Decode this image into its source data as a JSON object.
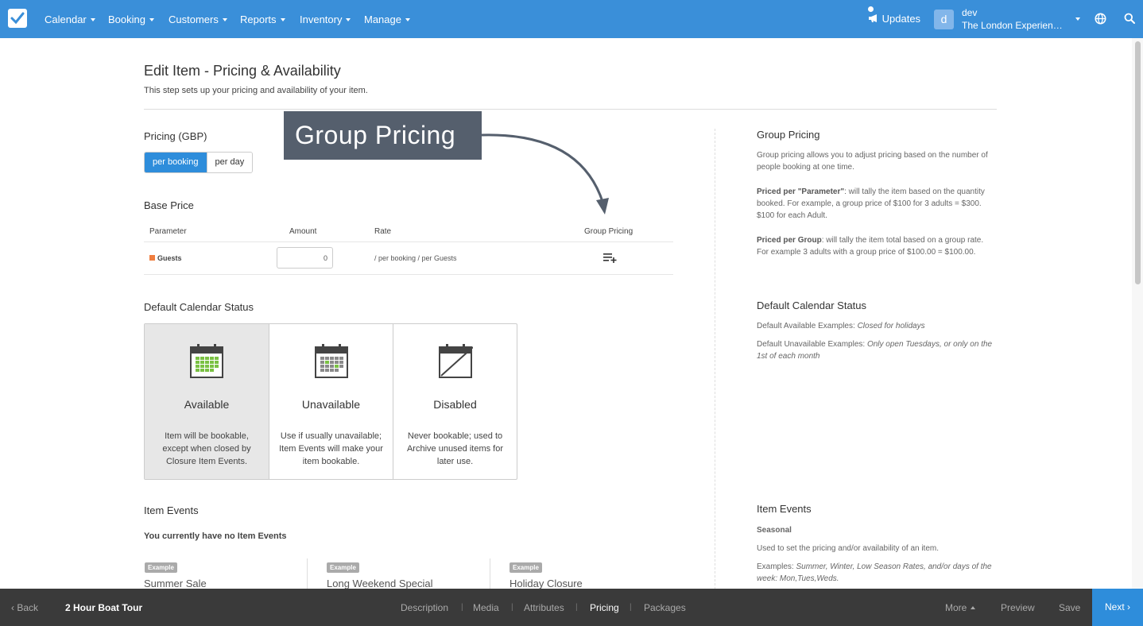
{
  "nav": {
    "items": [
      "Calendar",
      "Booking",
      "Customers",
      "Reports",
      "Inventory",
      "Manage"
    ],
    "updates_label": "Updates",
    "avatar_letter": "d",
    "user_name": "dev",
    "company": "The London Experience Co."
  },
  "page": {
    "title": "Edit Item - Pricing & Availability",
    "subtitle": "This step sets up your pricing and availability of your item."
  },
  "pricing": {
    "heading": "Pricing (GBP)",
    "mode_active": "per booking",
    "mode_inactive": "per day"
  },
  "callout": {
    "label": "Group Pricing"
  },
  "base_price": {
    "heading": "Base Price",
    "columns": [
      "Parameter",
      "Amount",
      "Rate",
      "Group Pricing"
    ],
    "row": {
      "parameter": "Guests",
      "amount": "0",
      "rate": "/ per booking / per Guests",
      "swatch_color": "#f07e3f"
    }
  },
  "calendar_status": {
    "heading": "Default Calendar Status",
    "cards": [
      {
        "title": "Available",
        "desc": "Item will be bookable, except when closed by Closure Item Events.",
        "icon": "calendar-available-icon"
      },
      {
        "title": "Unavailable",
        "desc": "Use if usually unavailable; Item Events will make your item bookable.",
        "icon": "calendar-unavailable-icon"
      },
      {
        "title": "Disabled",
        "desc": "Never bookable; used to Archive unused items for later use.",
        "icon": "calendar-disabled-icon"
      }
    ]
  },
  "item_events": {
    "heading": "Item Events",
    "empty_text": "You currently have no Item Events",
    "examples": [
      {
        "badge": "Example",
        "title": "Summer Sale"
      },
      {
        "badge": "Example",
        "title": "Long Weekend Special"
      },
      {
        "badge": "Example",
        "title": "Holiday Closure"
      }
    ]
  },
  "help": {
    "group_pricing": {
      "heading": "Group Pricing",
      "intro": "Group pricing allows you to adjust pricing based on the number of people booking at one time.",
      "param_bold": "Priced per \"Parameter\"",
      "param_text": ": will tally the item based on the quantity booked. For example, a group price of $100 for 3 adults = $300. $100 for each Adult.",
      "group_bold": "Priced per Group",
      "group_text": ": will tally the item total based on a group rate. For example 3 adults with a group price of $100.00 = $100.00."
    },
    "calendar_status": {
      "heading": "Default Calendar Status",
      "available_label": "Default Available Examples: ",
      "available_example": "Closed for holidays",
      "unavailable_label": "Default Unavailable Examples: ",
      "unavailable_example": "Only open Tuesdays, or only on the 1st of each month"
    },
    "item_events": {
      "heading": "Item Events",
      "subheading": "Seasonal",
      "desc": "Used to set the pricing and/or availability of an item.",
      "examples_label": "Examples: ",
      "examples_text": "Summer, Winter, Low Season Rates, and/or days of the week: Mon,Tues,Weds."
    }
  },
  "bottom": {
    "back": "Back",
    "item_title": "2 Hour Boat Tour",
    "steps": [
      "Description",
      "Media",
      "Attributes",
      "Pricing",
      "Packages"
    ],
    "active_step": "Pricing",
    "more": "More",
    "preview": "Preview",
    "save": "Save",
    "next": "Next"
  },
  "colors": {
    "brand": "#3a8fd9",
    "button_active": "#2e8ddb",
    "bottombar": "#3a3a3a",
    "callout": "#555f6d"
  }
}
